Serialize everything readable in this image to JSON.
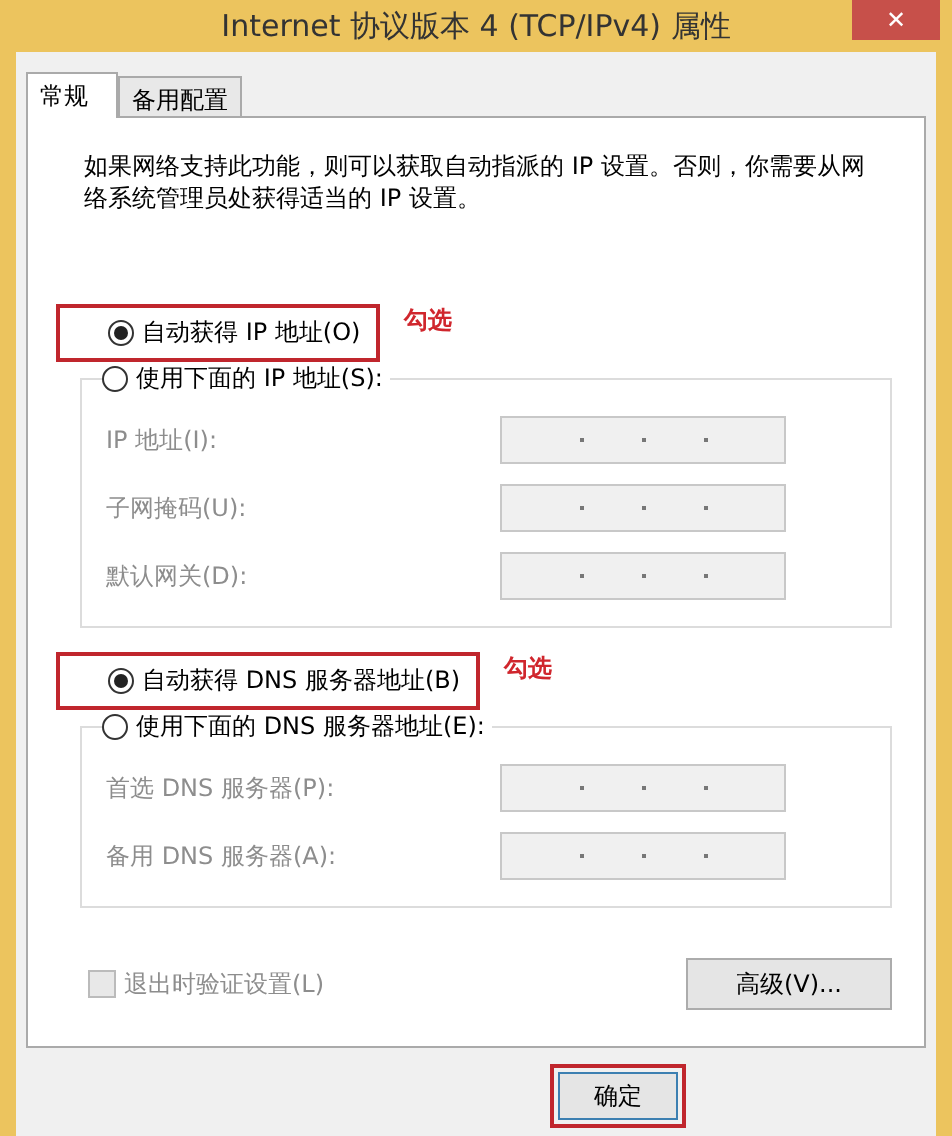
{
  "window": {
    "title": "Internet 协议版本 4 (TCP/IPv4) 属性",
    "close": "✕"
  },
  "tabs": [
    {
      "label": "常规",
      "selected": true
    },
    {
      "label": "备用配置",
      "selected": false
    }
  ],
  "description": "如果网络支持此功能，则可以获取自动指派的 IP 设置。否则，你需要从网络系统管理员处获得适当的 IP 设置。",
  "groups": [
    {
      "options": [
        {
          "label": "自动获得 IP 地址(O)",
          "selected": true,
          "highlighted": true,
          "note": "勾选"
        },
        {
          "label": "使用下面的 IP 地址(S):",
          "selected": false,
          "highlighted": false
        }
      ],
      "fields": [
        {
          "label": "IP 地址(I):",
          "disabled": true
        },
        {
          "label": "子网掩码(U):",
          "disabled": true
        },
        {
          "label": "默认网关(D):",
          "disabled": true
        }
      ]
    },
    {
      "options": [
        {
          "label": "自动获得 DNS 服务器地址(B)",
          "selected": true,
          "highlighted": true,
          "note": "勾选"
        },
        {
          "label": "使用下面的 DNS 服务器地址(E):",
          "selected": false,
          "highlighted": false
        }
      ],
      "fields": [
        {
          "label": "首选 DNS 服务器(P):",
          "disabled": true
        },
        {
          "label": "备用 DNS 服务器(A):",
          "disabled": true
        }
      ]
    }
  ],
  "validate_checkbox": {
    "label": "退出时验证设置(L)",
    "checked": false,
    "disabled": true
  },
  "advanced_button": {
    "label": "高级(V)..."
  },
  "ok_button": {
    "label": "确定",
    "highlighted": true
  }
}
